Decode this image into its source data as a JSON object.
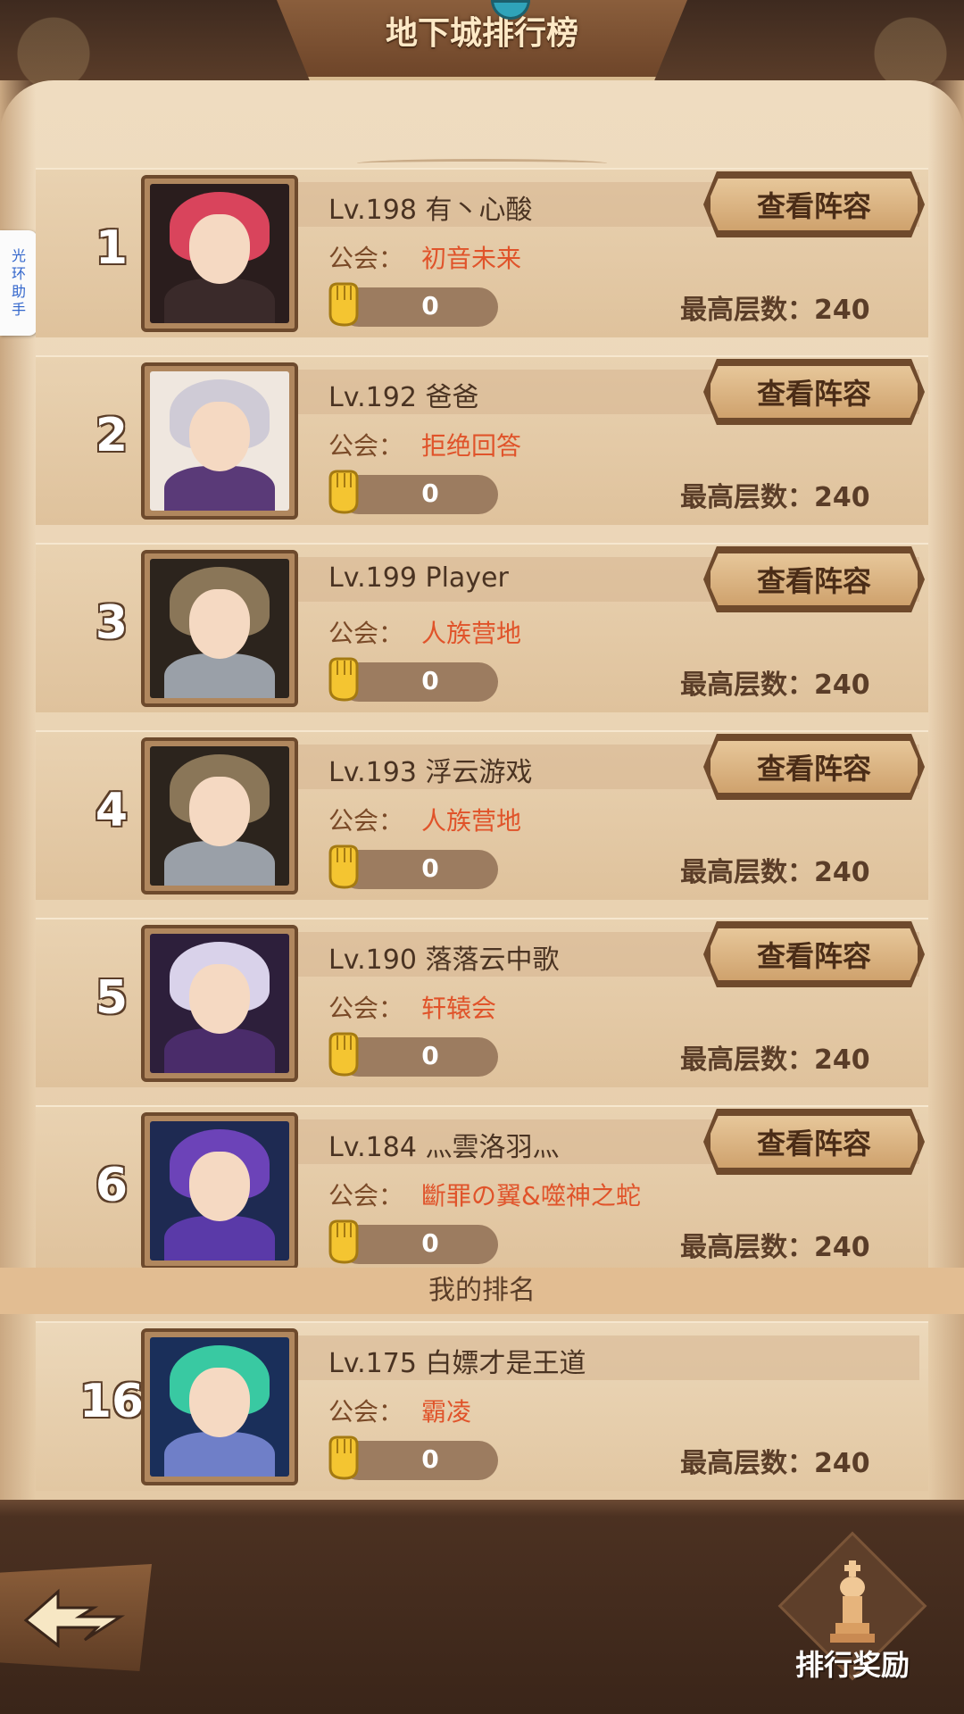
{
  "header": {
    "title": "地下城排行榜"
  },
  "helper": {
    "label": "光环助手"
  },
  "labels": {
    "view_lineup": "查看阵容",
    "guild_prefix": "公会：",
    "floor_prefix": "最高层数：",
    "my_rank": "我的排名",
    "reward": "排行奖励"
  },
  "entries": [
    {
      "rank": "1",
      "name": "Lv.198 有丶心酸",
      "guild": "初音未来",
      "likes": "0",
      "floor": "240",
      "avatar": "red-haired-elf-icon"
    },
    {
      "rank": "2",
      "name": "Lv.192 爸爸",
      "guild": "拒绝回答",
      "likes": "0",
      "floor": "240",
      "avatar": "horned-beast-icon"
    },
    {
      "rank": "3",
      "name": "Lv.199 Player",
      "guild": "人族营地",
      "likes": "0",
      "floor": "240",
      "avatar": "hooded-knight-icon"
    },
    {
      "rank": "4",
      "name": "Lv.193 浮云游戏",
      "guild": "人族营地",
      "likes": "0",
      "floor": "240",
      "avatar": "hooded-knight-icon"
    },
    {
      "rank": "5",
      "name": "Lv.190 落落云中歌",
      "guild": "轩辕会",
      "likes": "0",
      "floor": "240",
      "avatar": "silver-haired-vampire-icon"
    },
    {
      "rank": "6",
      "name": "Lv.184 灬雲洛羽灬",
      "guild": "斷罪の翼&噬神之蛇",
      "likes": "0",
      "floor": "240",
      "avatar": "purple-hooded-mage-icon"
    }
  ],
  "me": {
    "rank": "16",
    "name": "Lv.175 白嫖才是王道",
    "guild": "霸凌",
    "likes": "0",
    "floor": "240",
    "avatar": "green-haired-cyber-girl-icon"
  },
  "colors": {
    "guild_text": "#e0532a",
    "parchment": "#ead3b3",
    "frame": "#5a3a26"
  }
}
